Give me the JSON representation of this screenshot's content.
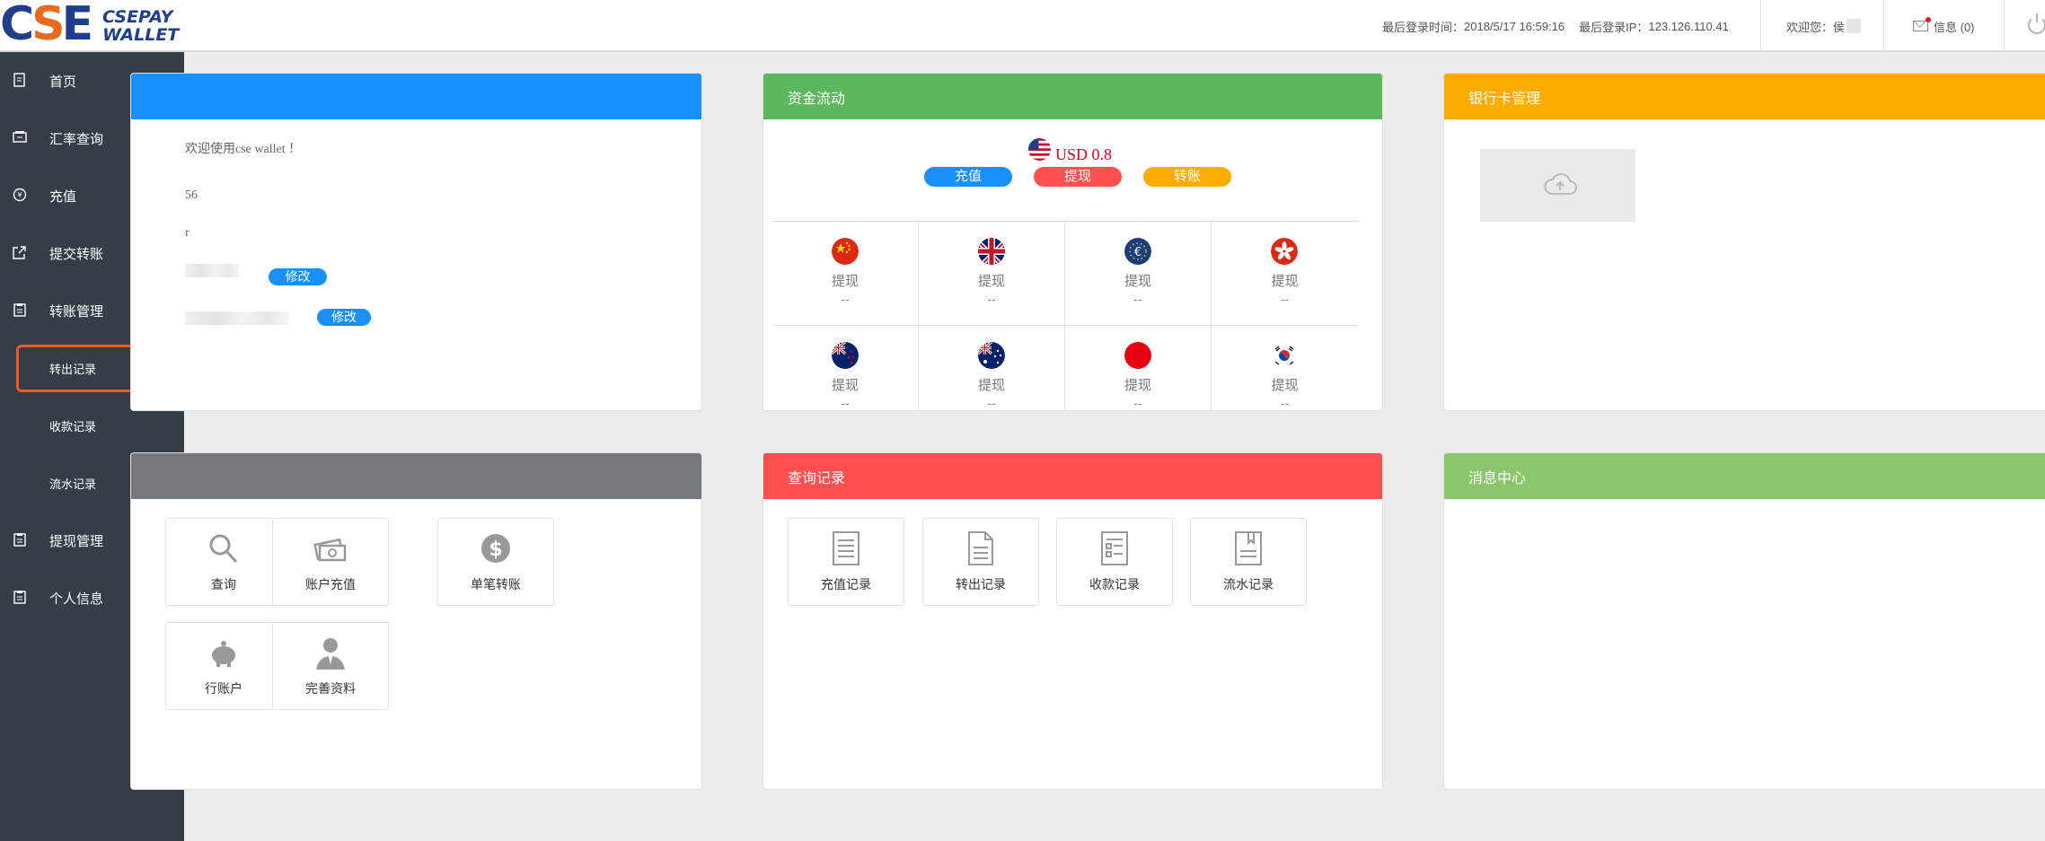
{
  "header": {
    "logo_main": "CSE",
    "logo_sub_1": "CSEPAY",
    "logo_sub_2": "WALLET",
    "last_login_time_label": "最后登录时间：",
    "last_login_time": "2018/5/17 16:59:16",
    "last_login_ip_label": "最后登录IP：",
    "last_login_ip": "123.126.110.41",
    "welcome": "欢迎您：侯",
    "messages": "信息 (0)"
  },
  "sidebar": {
    "items": [
      {
        "label": "首页",
        "icon": "file-icon"
      },
      {
        "label": "汇率查询",
        "icon": "exchange-icon"
      },
      {
        "label": "充值",
        "icon": "coin-icon"
      },
      {
        "label": "提交转账",
        "icon": "share-icon"
      },
      {
        "label": "转账管理",
        "icon": "clipboard-icon"
      },
      {
        "label": "转出记录",
        "sub": true,
        "active": true
      },
      {
        "label": "收款记录",
        "sub": true
      },
      {
        "label": "流水记录",
        "sub": true
      },
      {
        "label": "提现管理",
        "icon": "clipboard-icon"
      },
      {
        "label": "个人信息",
        "icon": "clipboard-icon"
      }
    ]
  },
  "account_card": {
    "welcome_text": "欢迎使用cse wallet ！",
    "line2": "56",
    "line3": "r",
    "edit_label": "修改",
    "edit_label_2": "修改",
    "head_color": "#1890ff"
  },
  "funds_card": {
    "title": "资金流动",
    "balance": "USD 0.8",
    "buttons": {
      "deposit": "充值",
      "withdraw": "提现",
      "transfer": "转账"
    },
    "currencies": [
      {
        "flag": "china-flag",
        "action": "提现",
        "value": "--"
      },
      {
        "flag": "uk-flag",
        "action": "提现",
        "value": "--"
      },
      {
        "flag": "eu-flag",
        "action": "提现",
        "value": "--"
      },
      {
        "flag": "hongkong-flag",
        "action": "提现",
        "value": "--"
      },
      {
        "flag": "newzealand-flag",
        "action": "提现",
        "value": "--"
      },
      {
        "flag": "australia-flag",
        "action": "提现",
        "value": "--"
      },
      {
        "flag": "japan-flag",
        "action": "提现",
        "value": "--"
      },
      {
        "flag": "korea-flag",
        "action": "提现",
        "value": "--"
      }
    ],
    "head_color": "#5cb85c"
  },
  "bank_card": {
    "title": "银行卡管理",
    "head_color": "#ffab00"
  },
  "shortcuts_card": {
    "tiles": [
      {
        "label": "查询",
        "icon": "search-icon"
      },
      {
        "label": "账户充值",
        "icon": "money-icon"
      },
      {
        "label": "单笔转账",
        "icon": "globe-dollar-icon"
      },
      {
        "label": "行账户",
        "icon": "piggy-icon"
      },
      {
        "label": "完善资料",
        "icon": "user-icon"
      }
    ],
    "head_color": "#75797e"
  },
  "records_card": {
    "title": "查询记录",
    "tiles": [
      {
        "label": "充值记录",
        "icon": "list-doc-icon"
      },
      {
        "label": "转出记录",
        "icon": "doc-icon"
      },
      {
        "label": "收款记录",
        "icon": "form-doc-icon"
      },
      {
        "label": "流水记录",
        "icon": "bookmark-doc-icon"
      }
    ],
    "head_color": "#ff5050"
  },
  "message_card": {
    "title": "消息中心",
    "head_color": "#8cc66c"
  }
}
